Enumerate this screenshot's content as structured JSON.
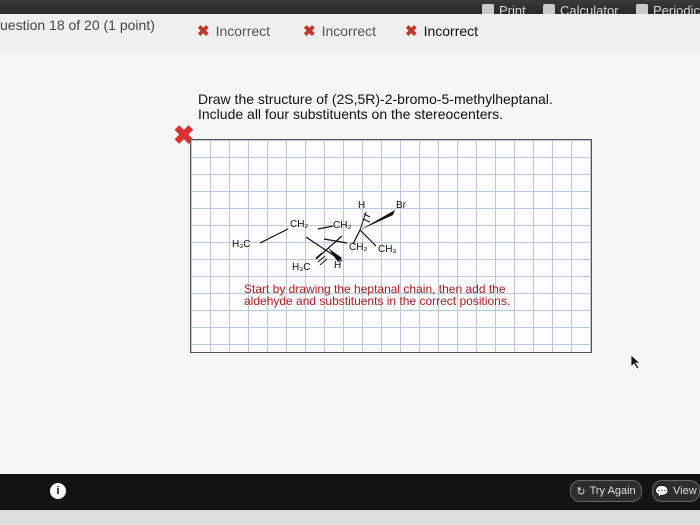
{
  "toolbar": {
    "print_label": "Print",
    "calculator_label": "Calculator",
    "periodic_label": "Periodic"
  },
  "question_header": {
    "counter": "uestion 18 of 20 (1 point)",
    "attempts": [
      "Incorrect",
      "Incorrect",
      "Incorrect"
    ]
  },
  "question": {
    "line1": "Draw the structure of (2S,5R)-2-bromo-5-methylheptanal.",
    "line2": "Include all four substituents on the stereocenters."
  },
  "molecule_labels": {
    "h3c_left": "H₃C",
    "ch2_a": "CH₂",
    "ch2_b": "CH₂",
    "ch2_c": "CH₂",
    "ch3_right": "CH₃",
    "h_top": "H",
    "br": "Br",
    "h3c_bottom": "H₃C",
    "h_bottom": "H"
  },
  "hint": {
    "line1": "Start by drawing the heptanal chain, then add the",
    "line2": "aldehyde and substituents in the correct positions."
  },
  "footer": {
    "info_label": "i",
    "try_again_label": "Try Again",
    "view_label": "View"
  }
}
